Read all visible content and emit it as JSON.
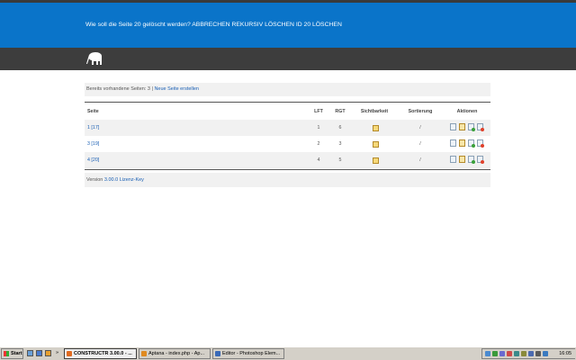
{
  "header": {
    "question": "Wie soll die Seite 20 gelöscht werden?",
    "actions": [
      "ABBRECHEN",
      "REKURSIV LÖSCHEN",
      "ID 20 LÖSCHEN"
    ]
  },
  "logo": {
    "icon": "elephant-logo-icon"
  },
  "info": {
    "prefix": "Bereits vorhandene Seiten: 3 |",
    "link": "Neue Seite erstellen"
  },
  "table": {
    "columns": [
      "Seite",
      "LFT",
      "RGT",
      "Sichtbarkeit",
      "Sortierung",
      "Aktionen"
    ],
    "rows": [
      {
        "seite": "1 [17]",
        "lft": "1",
        "rgt": "6",
        "sortierung": "/"
      },
      {
        "seite": "3 [19]",
        "lft": "2",
        "rgt": "3",
        "sortierung": "/"
      },
      {
        "seite": "4 [20]",
        "lft": "4",
        "rgt": "5",
        "sortierung": "/"
      }
    ]
  },
  "footer": {
    "prefix": "Version",
    "link": "3.00.0 Lizenz-Key"
  },
  "taskbar": {
    "start": "Start",
    "chevron": "»",
    "tasks": [
      "CONSTRUCTR 3.00.0 - ...",
      "Aptana - index.php - Ap...",
      "Editor - Photoshop Elem..."
    ],
    "clock": "16:05"
  },
  "colors": {
    "blue_bar": "#0a74c9",
    "dark_bar": "#3d3d3d",
    "link": "#1a5fb4"
  }
}
